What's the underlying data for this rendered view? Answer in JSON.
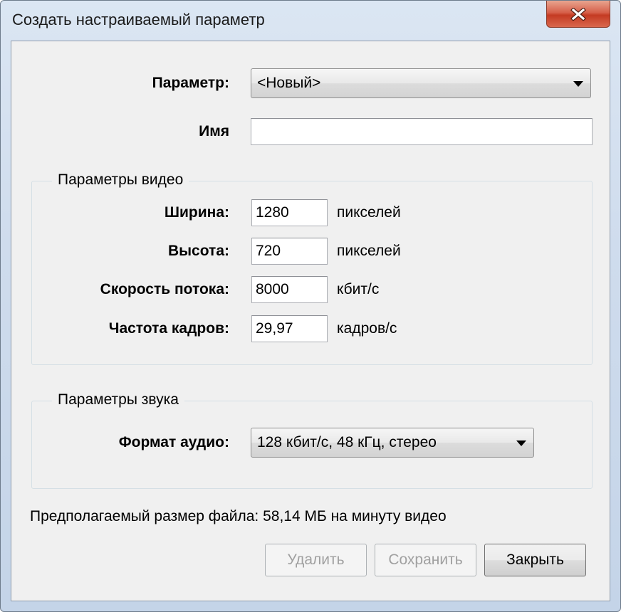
{
  "window": {
    "title": "Создать настраиваемый параметр"
  },
  "preset": {
    "label": "Параметр:",
    "value": "<Новый>"
  },
  "name": {
    "label": "Имя",
    "value": ""
  },
  "video": {
    "legend": "Параметры видео",
    "width": {
      "label": "Ширина:",
      "value": "1280",
      "unit": "пикселей"
    },
    "height": {
      "label": "Высота:",
      "value": "720",
      "unit": "пикселей"
    },
    "bitrate": {
      "label": "Скорость потока:",
      "value": "8000",
      "unit": "кбит/с"
    },
    "framerate": {
      "label": "Частота кадров:",
      "value": "29,97",
      "unit": "кадров/с"
    }
  },
  "audio": {
    "legend": "Параметры звука",
    "format": {
      "label": "Формат аудио:",
      "value": "128 кбит/с, 48 кГц, стерео"
    }
  },
  "estimate": {
    "text": "Предполагаемый размер файла: 58,14 МБ на минуту видео"
  },
  "buttons": {
    "delete": "Удалить",
    "save": "Сохранить",
    "close": "Закрыть"
  },
  "icons": {
    "window_close": "close-x-icon",
    "dropdown": "dropdown-arrow-icon"
  }
}
